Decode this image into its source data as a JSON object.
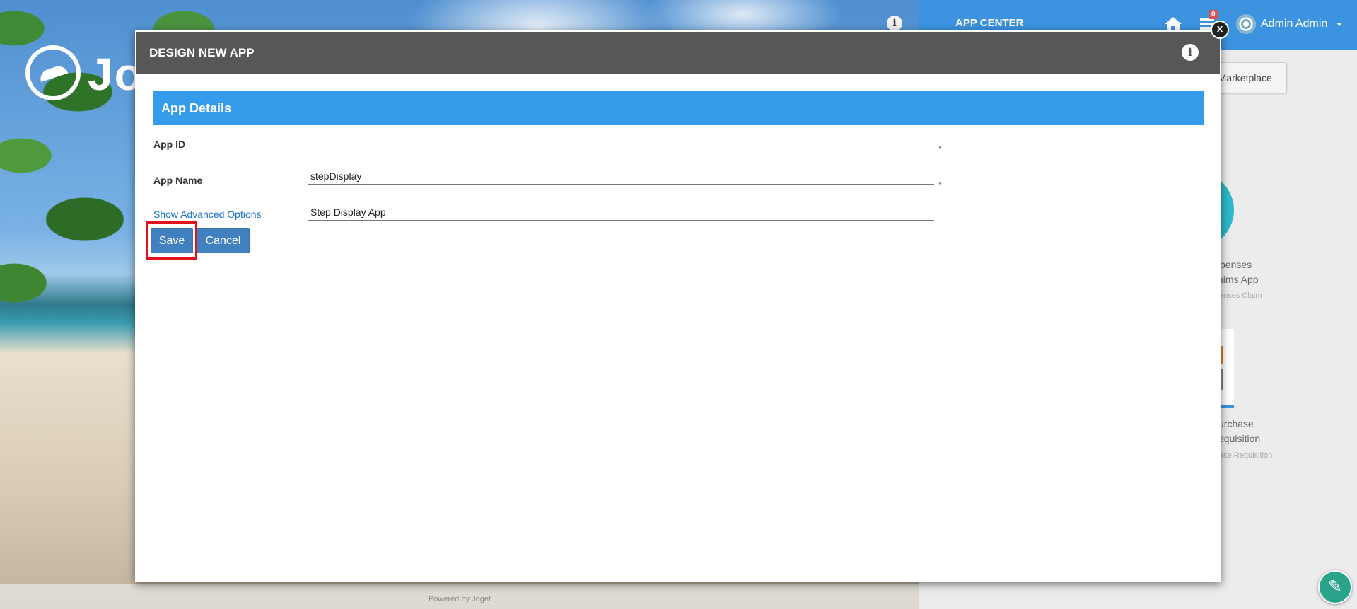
{
  "background": {
    "logo_text": "Jo",
    "footer_text": "Powered by Joget"
  },
  "topbar": {
    "title": "APP CENTER",
    "notification_count": "0",
    "user_name": "Admin Admin"
  },
  "marketplace_button": {
    "label": "n Marketplace"
  },
  "apps": [
    {
      "label_line1": "xpenses",
      "label_line2": "aims App",
      "sub": "enses Claim"
    },
    {
      "label_line1": "urchase",
      "label_line2": "equisition",
      "sub": "ase Requisition"
    }
  ],
  "modal": {
    "title": "DESIGN NEW APP",
    "close_label": "x",
    "section_title": "App Details",
    "fields": [
      {
        "label": "App ID",
        "value": "stepDisplay",
        "required_mark": "*"
      },
      {
        "label": "App Name",
        "value": "Step Display App",
        "required_mark": "*"
      }
    ],
    "advanced_link": "Show Advanced Options",
    "save_label": "Save",
    "cancel_label": "Cancel"
  },
  "colors": {
    "topbar": "#3c93df",
    "modal_header": "#575757",
    "section_header": "#359cec",
    "button": "#4181c0",
    "highlight": "#e3131b",
    "fab": "#2aa38b"
  }
}
